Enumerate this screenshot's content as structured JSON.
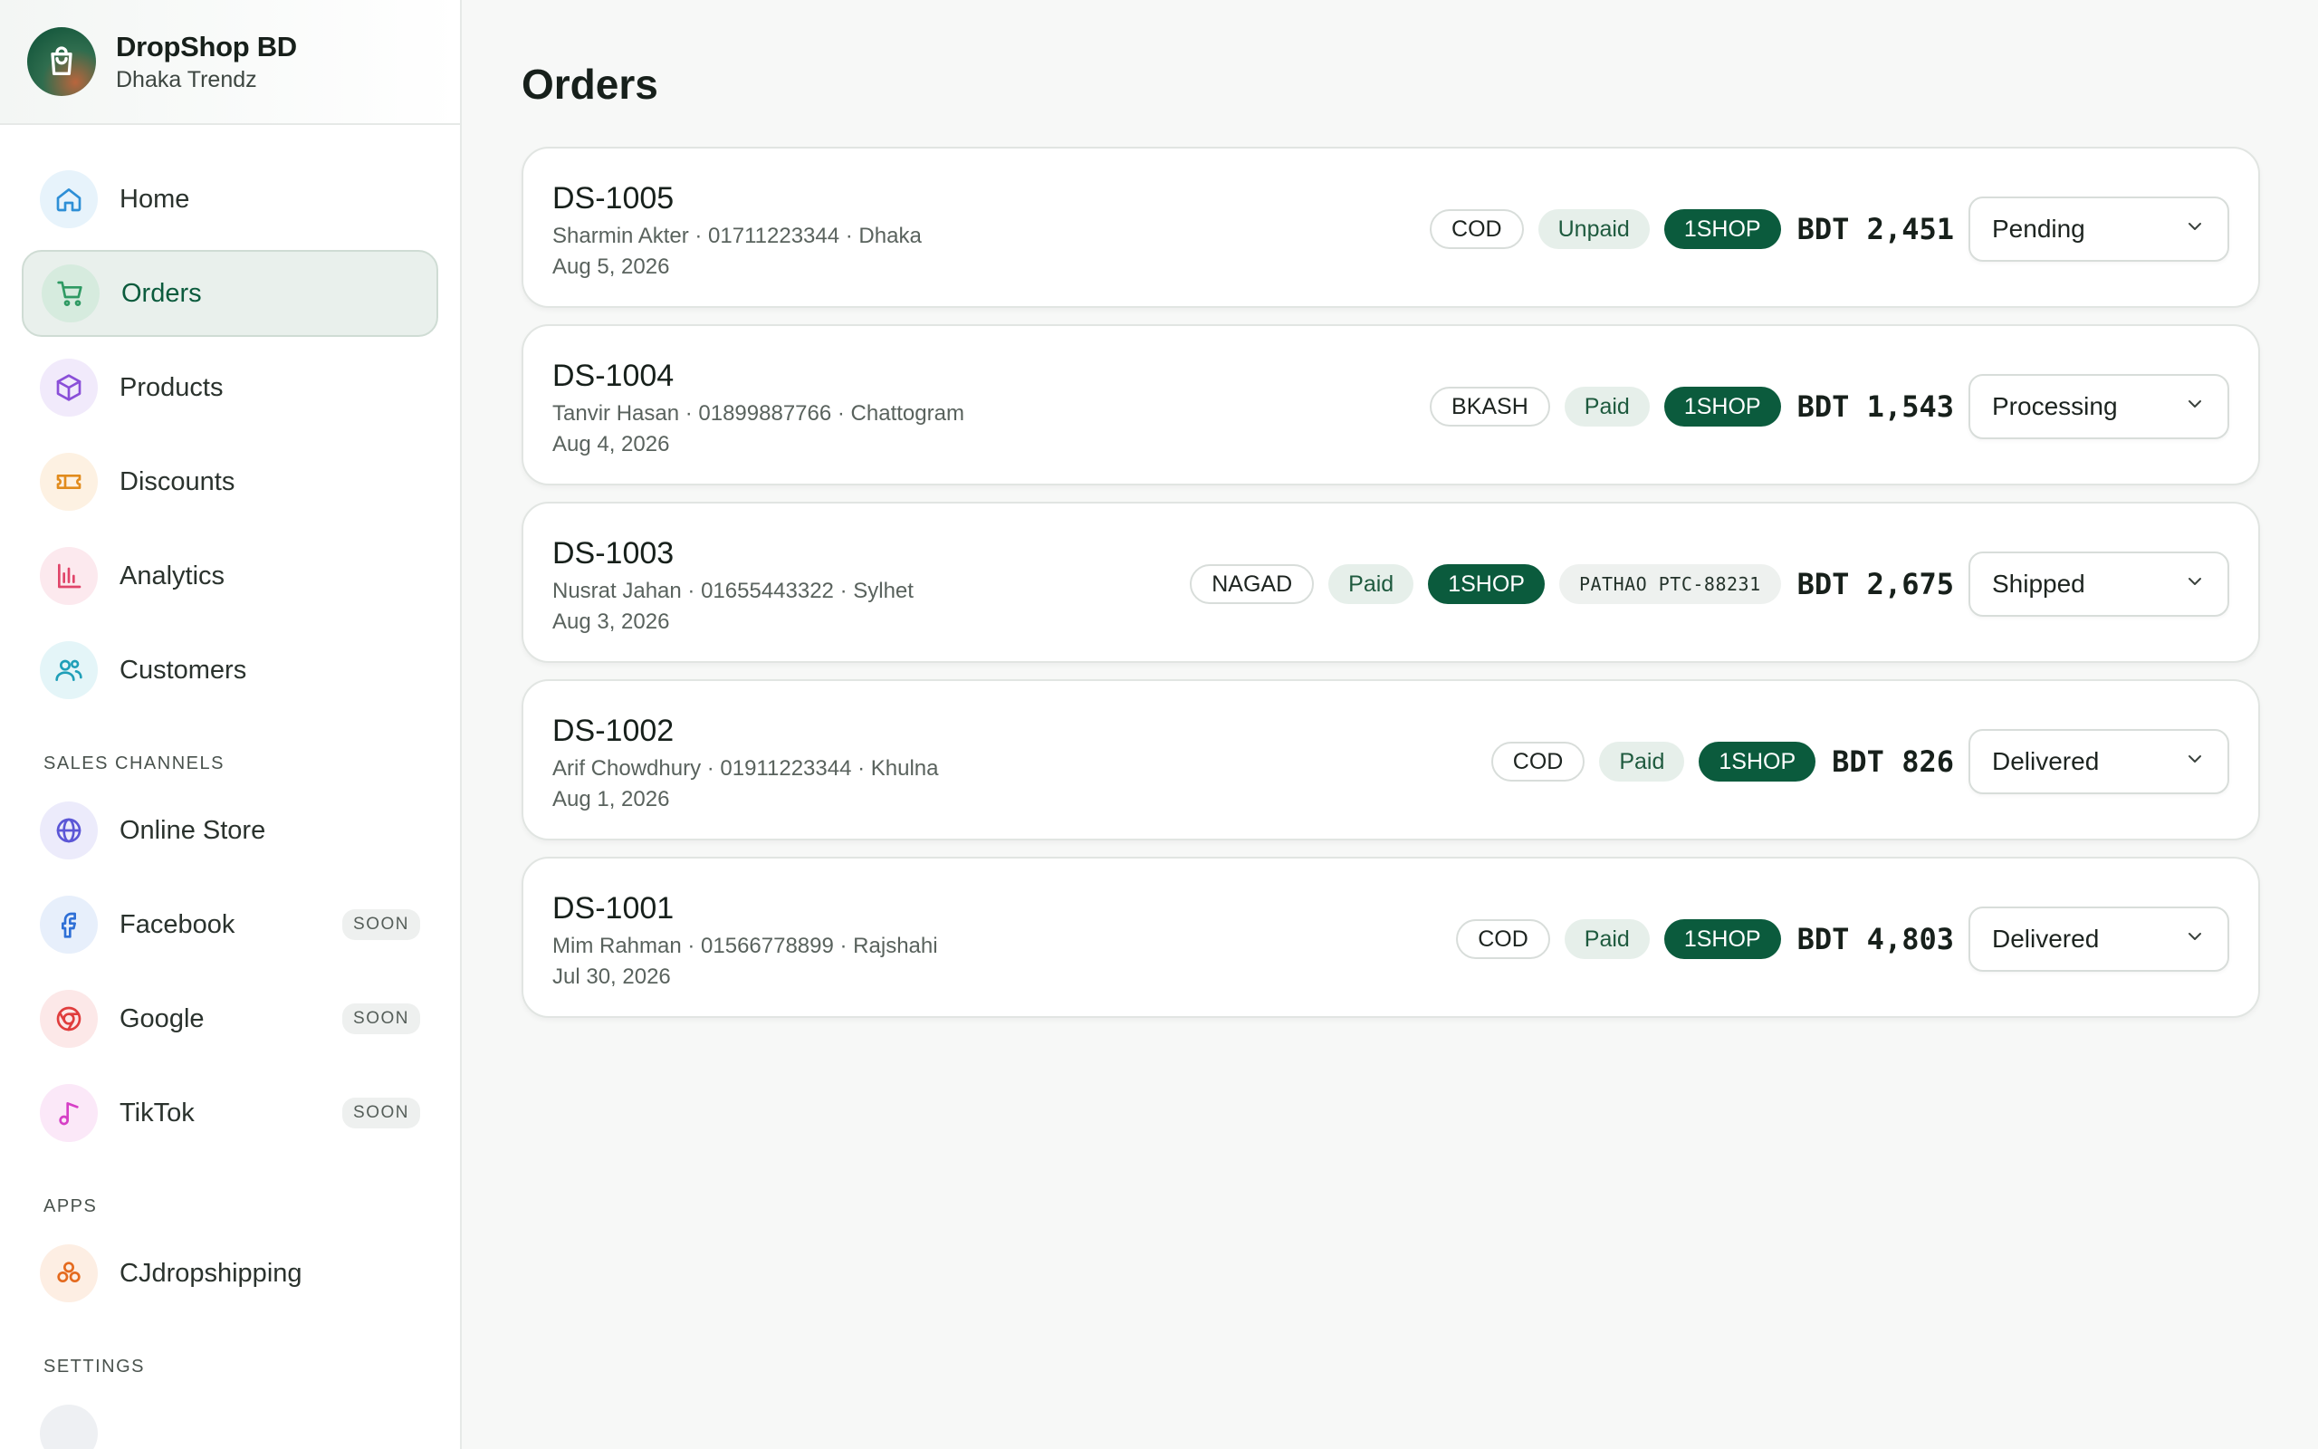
{
  "brand": {
    "name": "DropShop BD",
    "store": "Dhaka Trendz"
  },
  "nav": {
    "main": [
      {
        "id": "home",
        "label": "Home",
        "icon": "home-icon",
        "color": "#2e8fd6",
        "bg": "#e7f3fb"
      },
      {
        "id": "orders",
        "label": "Orders",
        "icon": "cart-icon",
        "color": "#2f9a63",
        "bg": "#d6ebde",
        "active": true
      },
      {
        "id": "products",
        "label": "Products",
        "icon": "box-icon",
        "color": "#8a4fd8",
        "bg": "#f1eafb"
      },
      {
        "id": "discounts",
        "label": "Discounts",
        "icon": "ticket-icon",
        "color": "#e18b1c",
        "bg": "#fdf1e2"
      },
      {
        "id": "analytics",
        "label": "Analytics",
        "icon": "bar-chart-icon",
        "color": "#e0456a",
        "bg": "#fce9ee"
      },
      {
        "id": "customers",
        "label": "Customers",
        "icon": "users-icon",
        "color": "#1f9fb8",
        "bg": "#e4f5f8"
      }
    ],
    "sales_channels_label": "SALES CHANNELS",
    "sales_channels": [
      {
        "id": "online-store",
        "label": "Online Store",
        "icon": "globe-icon",
        "color": "#5b56d6",
        "bg": "#ecebfb"
      },
      {
        "id": "facebook",
        "label": "Facebook",
        "icon": "facebook-icon",
        "color": "#2e6fd6",
        "bg": "#e7effb",
        "badge": "SOON"
      },
      {
        "id": "google",
        "label": "Google",
        "icon": "google-icon",
        "color": "#e03d3d",
        "bg": "#fce8e8",
        "badge": "SOON"
      },
      {
        "id": "tiktok",
        "label": "TikTok",
        "icon": "music-note-icon",
        "color": "#d63fc6",
        "bg": "#fbe8f8",
        "badge": "SOON"
      }
    ],
    "apps_label": "APPS",
    "apps": [
      {
        "id": "cjdropshipping",
        "label": "CJdropshipping",
        "icon": "cj-icon",
        "color": "#e46a1e",
        "bg": "#fdeee3"
      }
    ],
    "settings_label": "SETTINGS"
  },
  "page": {
    "title": "Orders"
  },
  "orders": [
    {
      "id": "DS-1005",
      "meta": "Sharmin Akter · 01711223344 · Dhaka",
      "date": "Aug 5, 2026",
      "method": "COD",
      "payment": "Unpaid",
      "channel": "1SHOP",
      "tracking": "",
      "amount": "BDT 2,451",
      "status": "Pending"
    },
    {
      "id": "DS-1004",
      "meta": "Tanvir Hasan · 01899887766 · Chattogram",
      "date": "Aug 4, 2026",
      "method": "BKASH",
      "payment": "Paid",
      "channel": "1SHOP",
      "tracking": "",
      "amount": "BDT 1,543",
      "status": "Processing"
    },
    {
      "id": "DS-1003",
      "meta": "Nusrat Jahan · 01655443322 · Sylhet",
      "date": "Aug 3, 2026",
      "method": "NAGAD",
      "payment": "Paid",
      "channel": "1SHOP",
      "tracking": "PATHAO PTC-88231",
      "amount": "BDT 2,675",
      "status": "Shipped"
    },
    {
      "id": "DS-1002",
      "meta": "Arif Chowdhury · 01911223344 · Khulna",
      "date": "Aug 1, 2026",
      "method": "COD",
      "payment": "Paid",
      "channel": "1SHOP",
      "tracking": "",
      "amount": "BDT 826",
      "status": "Delivered"
    },
    {
      "id": "DS-1001",
      "meta": "Mim Rahman · 01566778899 · Rajshahi",
      "date": "Jul 30, 2026",
      "method": "COD",
      "payment": "Paid",
      "channel": "1SHOP",
      "tracking": "",
      "amount": "BDT 4,803",
      "status": "Delivered"
    }
  ],
  "status_options": [
    "Pending",
    "Processing",
    "Shipped",
    "Delivered"
  ]
}
